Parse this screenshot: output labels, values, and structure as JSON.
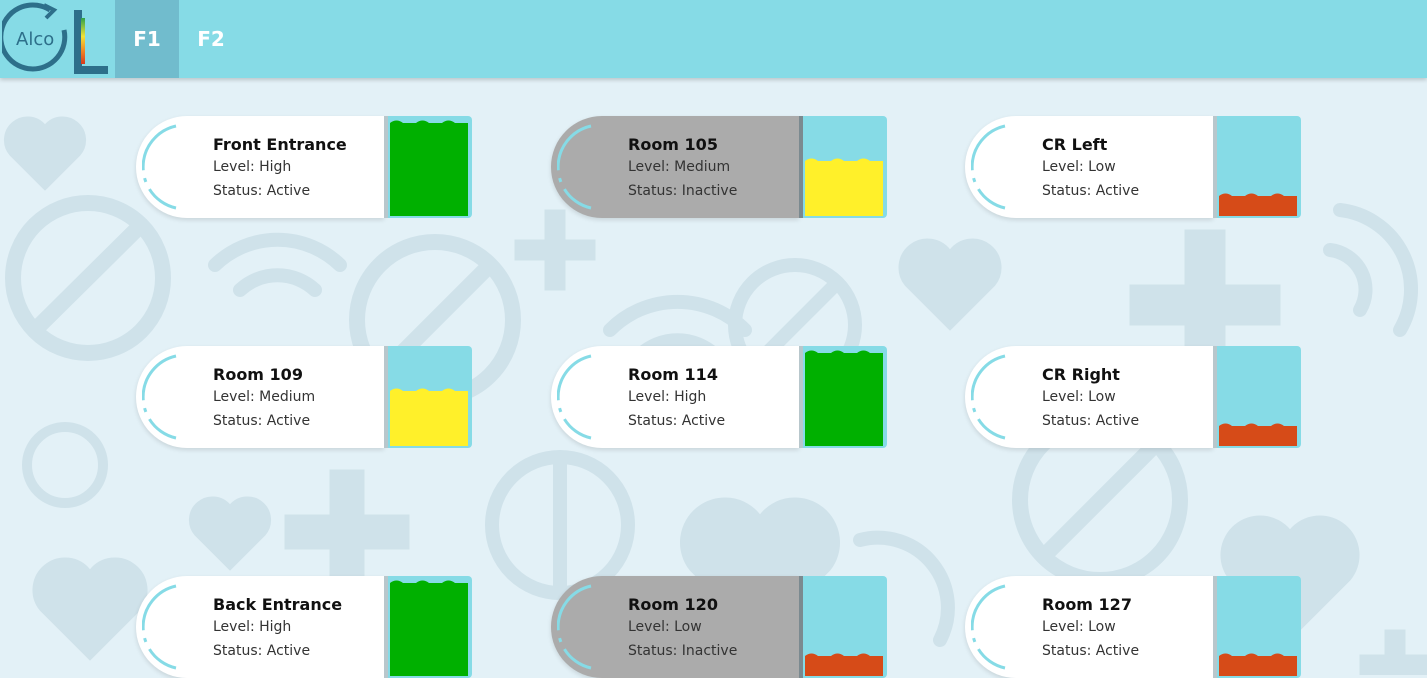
{
  "app": {
    "logo_text": "Alco",
    "logo_letter": "L"
  },
  "nav": {
    "tabs": [
      {
        "label": "F1",
        "active": true
      },
      {
        "label": "F2",
        "active": false
      }
    ]
  },
  "colors": {
    "navbar": "#86dbe6",
    "page_background": "#e3f1f7",
    "gauge_background": "#86dbe6",
    "level_high": "#00b000",
    "level_medium": "#fff02a",
    "level_low": "#d64b18",
    "inactive_card": "#ababab"
  },
  "dispensers": [
    {
      "name": "Front Entrance",
      "level_text": "Level: High",
      "status_text": "Status: Active",
      "level": "high",
      "fill_fraction": 0.95,
      "active": true
    },
    {
      "name": "Room 105",
      "level_text": "Level: Medium",
      "status_text": "Status: Inactive",
      "level": "medium",
      "fill_fraction": 0.56,
      "active": false
    },
    {
      "name": "CR Left",
      "level_text": "Level: Low",
      "status_text": "Status: Active",
      "level": "low",
      "fill_fraction": 0.2,
      "active": true
    },
    {
      "name": "Room 109",
      "level_text": "Level: Medium",
      "status_text": "Status: Active",
      "level": "medium",
      "fill_fraction": 0.56,
      "active": true
    },
    {
      "name": "Room 114",
      "level_text": "Level: High",
      "status_text": "Status: Active",
      "level": "high",
      "fill_fraction": 0.95,
      "active": true
    },
    {
      "name": "CR Right",
      "level_text": "Level: Low",
      "status_text": "Status: Active",
      "level": "low",
      "fill_fraction": 0.2,
      "active": true
    },
    {
      "name": "Back Entrance",
      "level_text": "Level: High",
      "status_text": "Status: Active",
      "level": "high",
      "fill_fraction": 0.95,
      "active": true
    },
    {
      "name": "Room 120",
      "level_text": "Level: Low",
      "status_text": "Status: Inactive",
      "level": "low",
      "fill_fraction": 0.2,
      "active": false
    },
    {
      "name": "Room 127",
      "level_text": "Level: Low",
      "status_text": "Status: Active",
      "level": "low",
      "fill_fraction": 0.2,
      "active": true
    }
  ]
}
